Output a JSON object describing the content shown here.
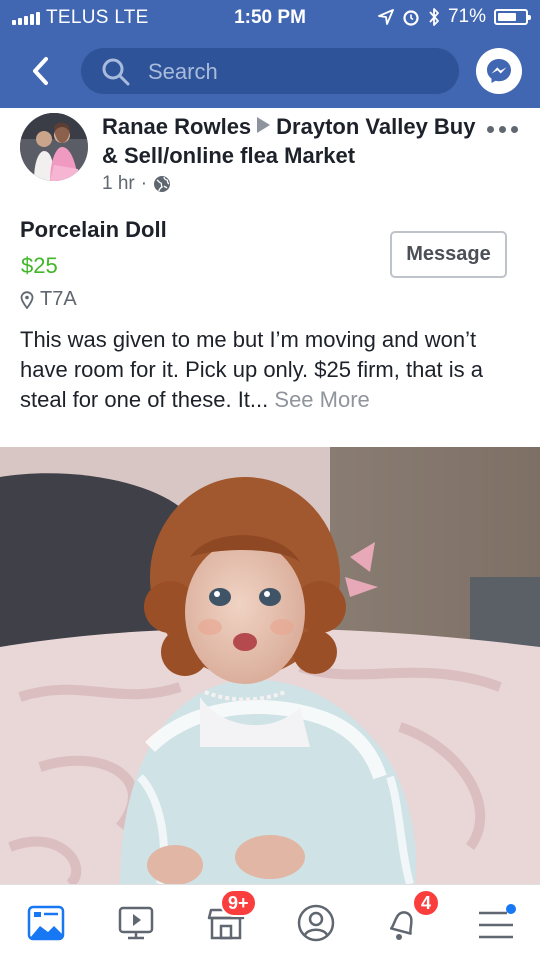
{
  "status_bar": {
    "carrier": "TELUS  LTE",
    "time": "1:50 PM",
    "battery": "71%",
    "battery_level": 0.71
  },
  "header": {
    "search_placeholder": "Search"
  },
  "post": {
    "author": "Ranae Rowles",
    "group": "Drayton Valley Buy & Sell/online flea Market",
    "time": "1 hr",
    "audience_icon": "globe-icon"
  },
  "listing": {
    "title": "Porcelain Doll",
    "price": "$25",
    "location": "T7A",
    "message_button": "Message",
    "description": "This was given to me but I’m moving and won’t have room for it. Pick up only. $25 firm, that is a steal for one of these. It...",
    "see_more": "See More"
  },
  "bottom_nav": {
    "tabs": [
      "news-feed-icon",
      "watch-icon",
      "marketplace-icon",
      "profile-icon",
      "notifications-icon",
      "menu-icon"
    ],
    "marketplace_badge": "9+",
    "notifications_badge": "4"
  },
  "colors": {
    "brand": "#4267b2",
    "price": "#42b72a",
    "badge": "#fa3e3e"
  }
}
